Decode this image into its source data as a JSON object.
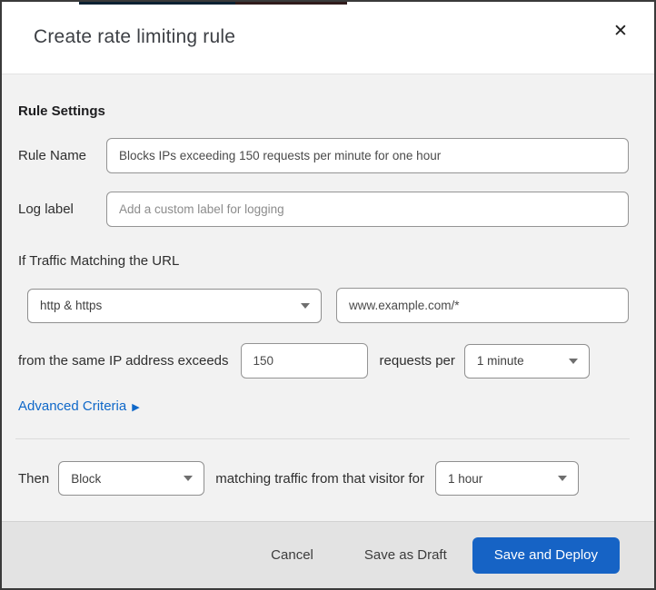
{
  "backdrop": {
    "navy_sliver_color": "#0b2233",
    "maroon_sliver_color": "#301b1b"
  },
  "dialog": {
    "title": "Create rate limiting rule",
    "close_icon": "✕",
    "section_heading": "Rule Settings",
    "rule_name": {
      "label": "Rule Name",
      "value": "Blocks IPs exceeding 150 requests per minute for one hour"
    },
    "log_label": {
      "label": "Log label",
      "placeholder": "Add a custom label for logging"
    },
    "match": {
      "heading": "If Traffic Matching the URL",
      "scheme_selected": "http & https",
      "url_value": "www.example.com/*",
      "threshold_prefix": "from the same IP address exceeds",
      "threshold_value": "150",
      "threshold_suffix": "requests per",
      "period_selected": "1 minute",
      "advanced_link": "Advanced Criteria",
      "advanced_arrow": "▶"
    },
    "action": {
      "prefix": "Then",
      "action_selected": "Block",
      "middle_text": "matching traffic from that visitor for",
      "duration_selected": "1 hour"
    },
    "footer": {
      "cancel_label": "Cancel",
      "save_draft_label": "Save as Draft",
      "save_deploy_label": "Save and Deploy",
      "primary_button_color": "#1663c5",
      "link_color": "#0f68c9"
    }
  }
}
